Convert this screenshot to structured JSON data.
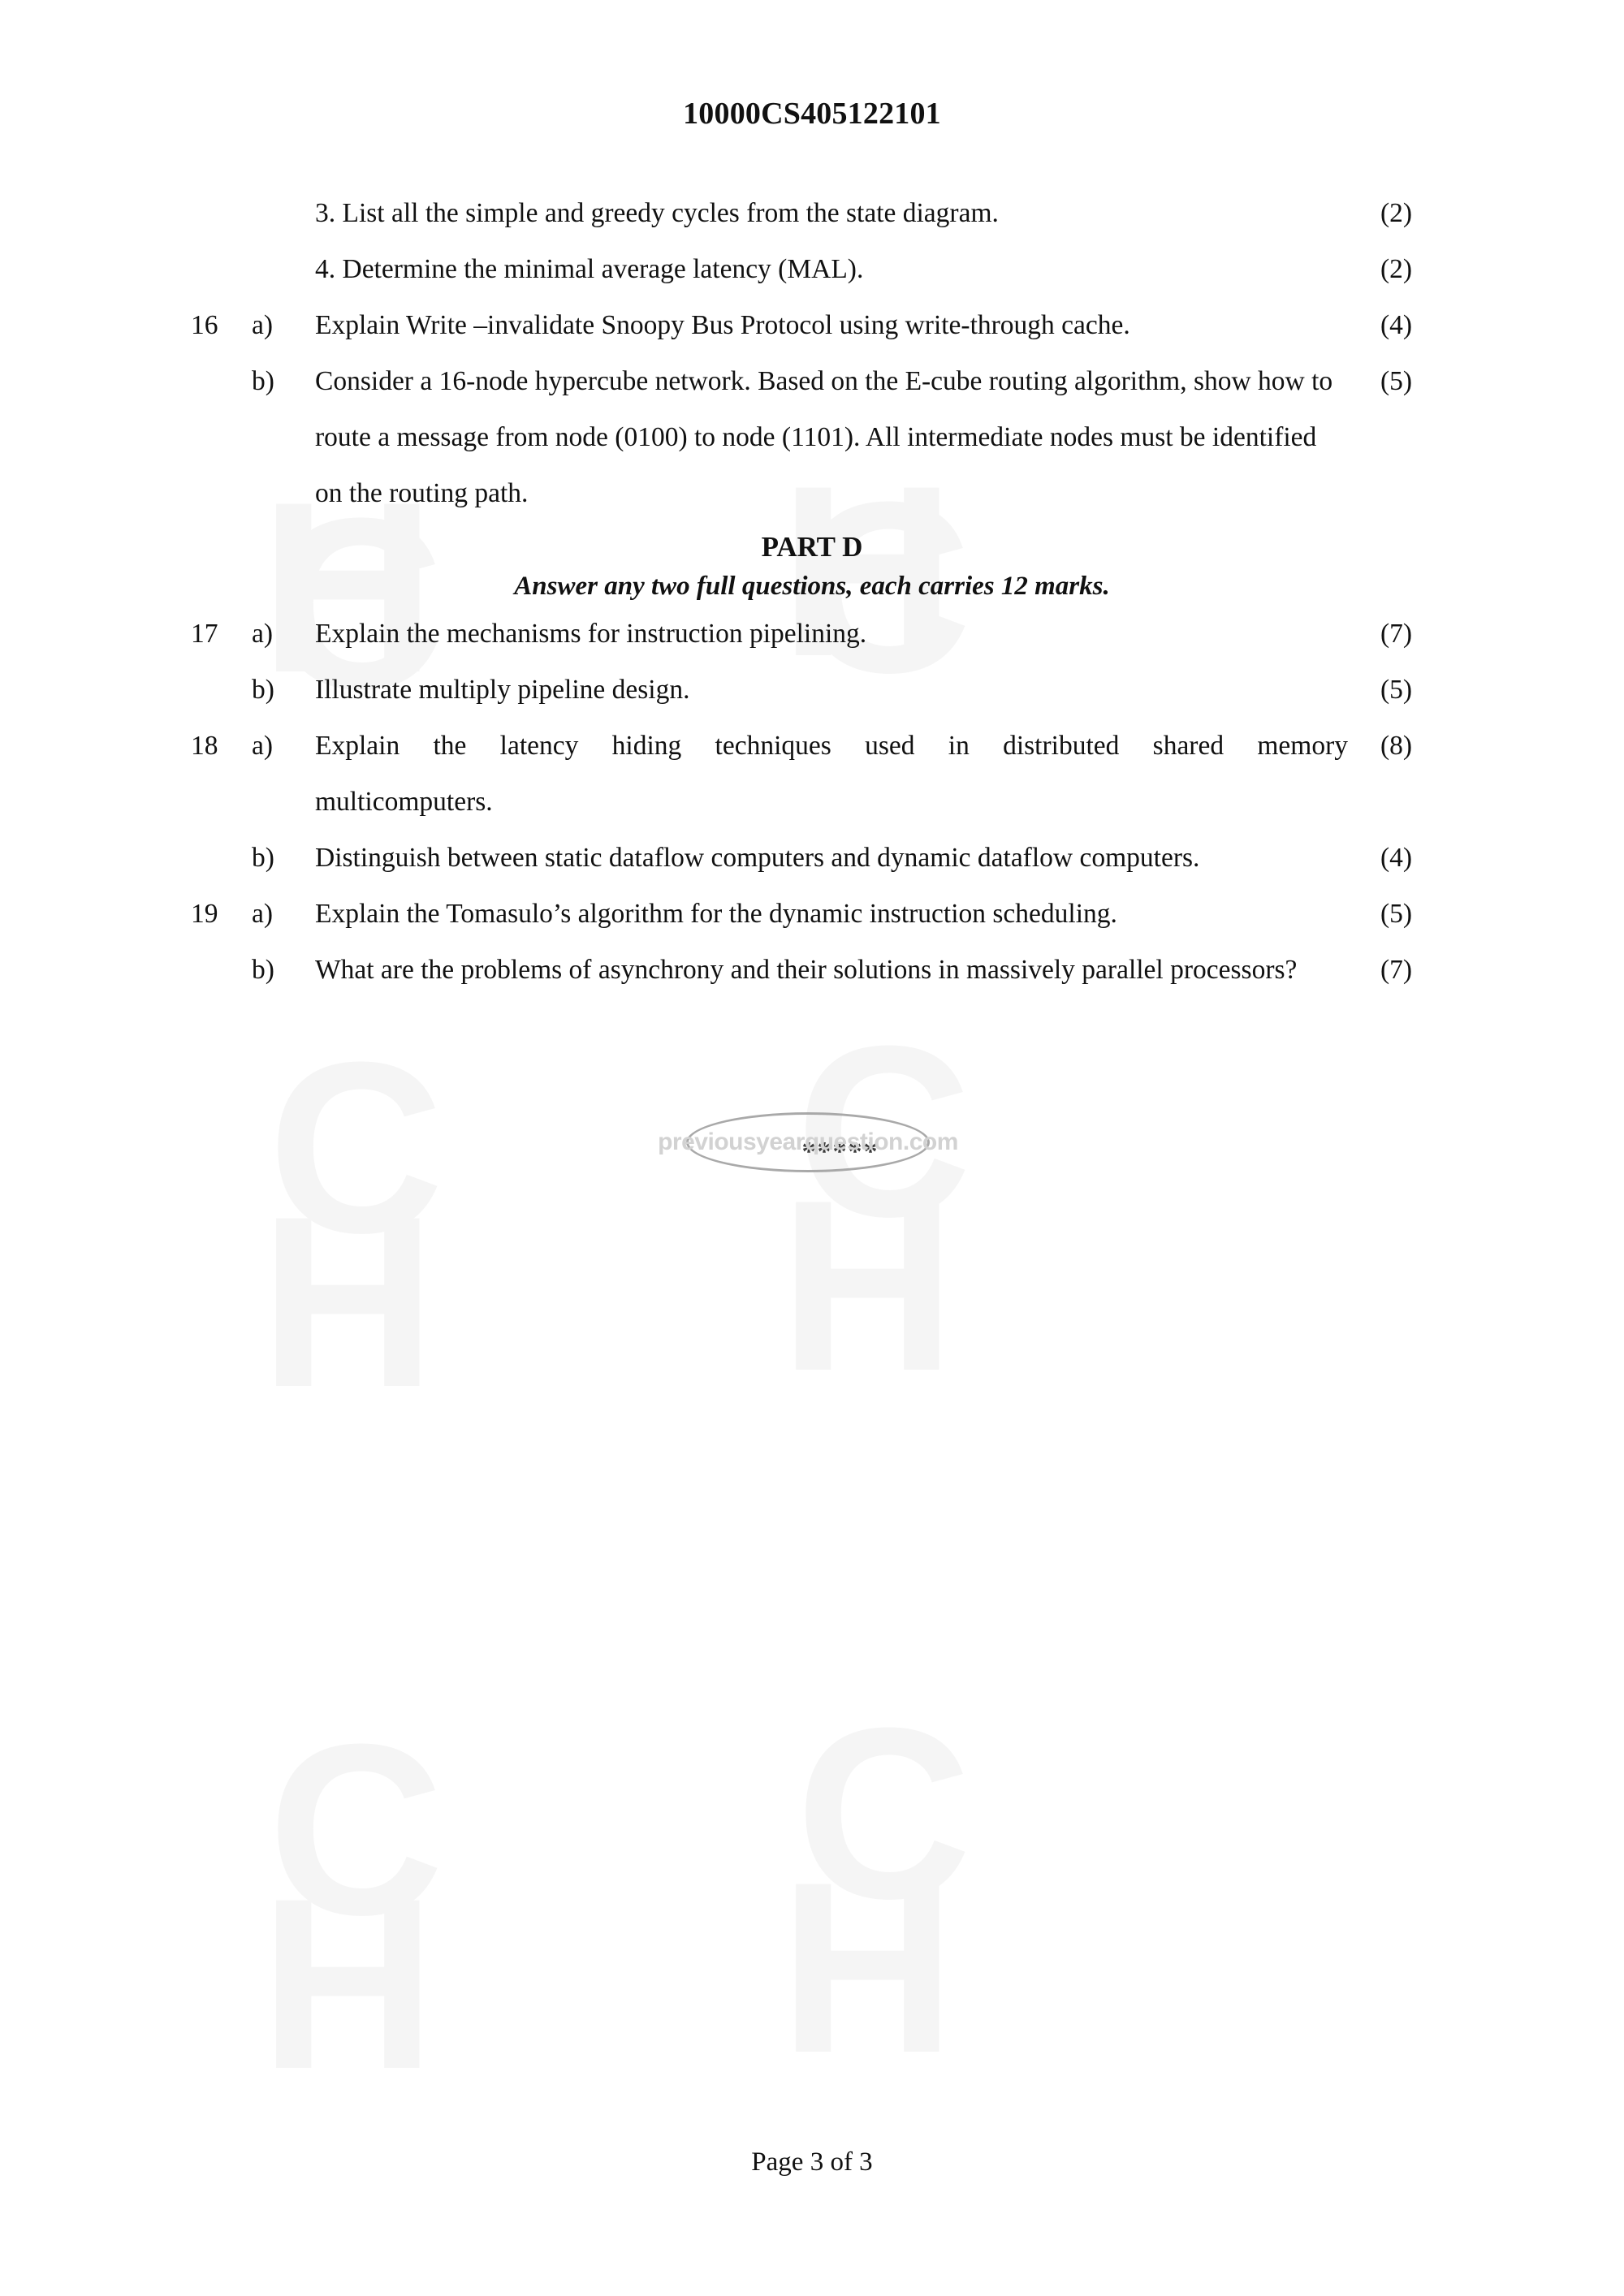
{
  "header": {
    "exam_code": "10000CS405122101"
  },
  "continued_items": [
    {
      "text": "3. List all the simple and greedy cycles from the state diagram.",
      "marks": "(2)"
    },
    {
      "text": "4. Determine the minimal average latency (MAL).",
      "marks": "(2)"
    }
  ],
  "questions_before_part": [
    {
      "number": "16",
      "parts": [
        {
          "letter": "a)",
          "text": "Explain Write –invalidate Snoopy Bus Protocol using write-through cache.",
          "marks": "(4)",
          "justified": false
        },
        {
          "letter": "b)",
          "text": "Consider a 16-node hypercube network. Based on the E-cube routing algorithm, show how to route a message from node (0100) to node (1101). All intermediate nodes must be identified on the routing path.",
          "marks": "(5)",
          "justified": false
        }
      ]
    }
  ],
  "part": {
    "title": "PART D",
    "instruction": "Answer any two full questions, each carries 12 marks."
  },
  "questions_after_part": [
    {
      "number": "17",
      "parts": [
        {
          "letter": "a)",
          "text": "Explain the mechanisms for instruction pipelining.",
          "marks": "(7)",
          "justified": false
        },
        {
          "letter": "b)",
          "text": "Illustrate multiply pipeline design.",
          "marks": "(5)",
          "justified": false
        }
      ]
    },
    {
      "number": "18",
      "parts": [
        {
          "letter": "a)",
          "line1": "Explain the latency hiding techniques used in distributed shared memory",
          "line2": "multicomputers.",
          "marks": "(8)",
          "justified": true
        },
        {
          "letter": "b)",
          "text": "Distinguish between static dataflow computers and dynamic dataflow computers.",
          "marks": "(4)",
          "justified": false
        }
      ]
    },
    {
      "number": "19",
      "parts": [
        {
          "letter": "a)",
          "text": "Explain the Tomasulo’s algorithm for the dynamic instruction scheduling.",
          "marks": "(5)",
          "justified": false
        },
        {
          "letter": "b)",
          "text": "What are the problems of asynchrony and their solutions in massively parallel processors?",
          "marks": "(7)",
          "justified": false
        }
      ]
    }
  ],
  "separator": {
    "asterisks": "*****"
  },
  "watermark": {
    "site": "previousyearquestion.com",
    "ghost_letters": [
      "C",
      "H"
    ],
    "ghost_color": "#f5f5f5"
  },
  "footer": {
    "page_label": "Page 3 of 3"
  }
}
